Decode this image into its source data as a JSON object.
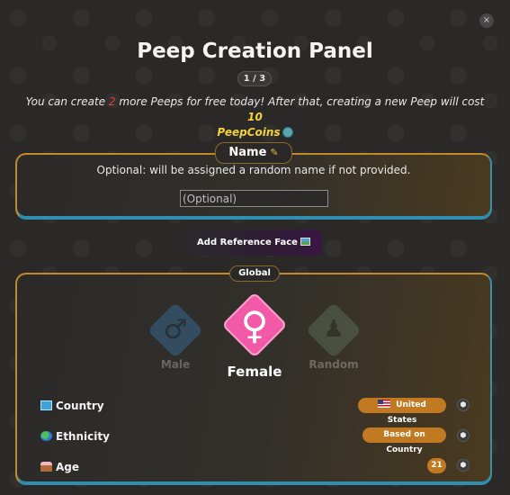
{
  "window": {
    "close_label": "×",
    "title": "Peep Creation Panel",
    "step": "1 / 3"
  },
  "info": {
    "prefix": "You can create ",
    "count": "2",
    "middle": " more Peeps for free today! After that, creating a new Peep will cost ",
    "cost": "10",
    "currency": "PeepCoins"
  },
  "name_section": {
    "label": "Name",
    "description": "Optional: will be assigned a random name if not provided.",
    "input_placeholder": "(Optional)",
    "input_value": ""
  },
  "reference_button": {
    "label": "Add Reference Face"
  },
  "global_section": {
    "label": "Global",
    "genders": [
      {
        "label": "Male",
        "symbol": "♂",
        "selected": false
      },
      {
        "label": "Female",
        "symbol": "♀",
        "selected": true
      },
      {
        "label": "Random",
        "symbol": "♟",
        "selected": false
      }
    ],
    "rows": [
      {
        "label": "Country",
        "value": "United States",
        "icon": "map-icon"
      },
      {
        "label": "Ethnicity",
        "value": "Based on Country",
        "icon": "globe-icon"
      },
      {
        "label": "Age",
        "value": "21",
        "icon": "cake-icon"
      }
    ],
    "dice_symbol": "⬢"
  },
  "colors": {
    "accent_gold": "#c28a2a",
    "accent_blue": "#2f8fb0",
    "female_pink": "#f25aa8",
    "pill_orange": "#c27a22",
    "highlight_red": "#e23b3b",
    "highlight_yellow": "#f3d23a"
  }
}
